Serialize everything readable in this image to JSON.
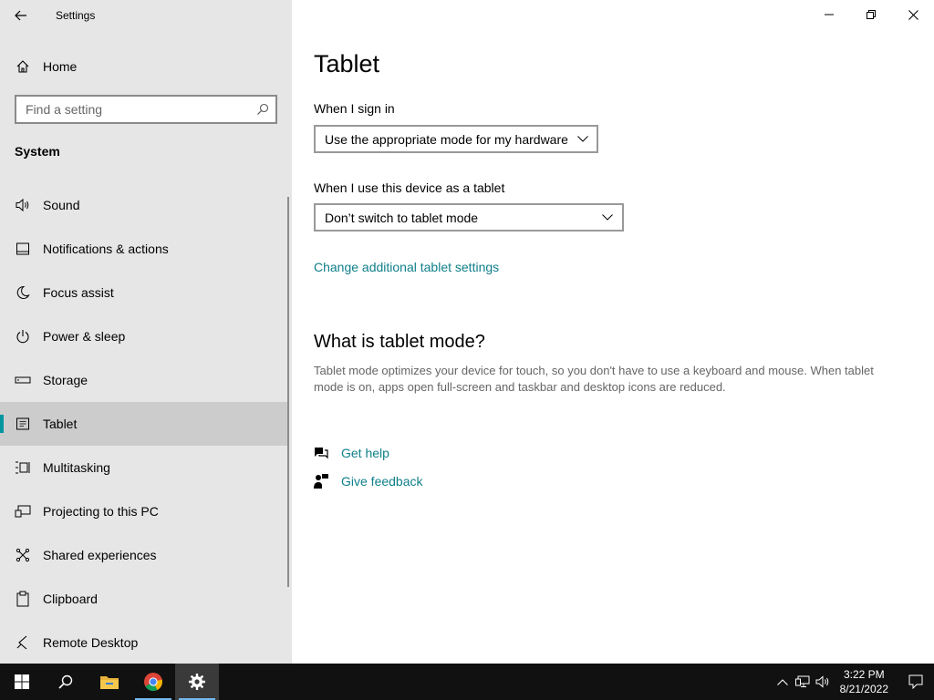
{
  "window": {
    "title": "Settings",
    "controls": [
      "minimize",
      "restore",
      "close"
    ]
  },
  "sidebar": {
    "home_label": "Home",
    "search_placeholder": "Find a setting",
    "section_title": "System",
    "items": [
      {
        "label": "Sound",
        "icon": "speaker-icon"
      },
      {
        "label": "Notifications & actions",
        "icon": "notification-icon"
      },
      {
        "label": "Focus assist",
        "icon": "moon-icon"
      },
      {
        "label": "Power & sleep",
        "icon": "power-icon"
      },
      {
        "label": "Storage",
        "icon": "storage-icon"
      },
      {
        "label": "Tablet",
        "icon": "tablet-icon",
        "active": true
      },
      {
        "label": "Multitasking",
        "icon": "multitasking-icon"
      },
      {
        "label": "Projecting to this PC",
        "icon": "projecting-icon"
      },
      {
        "label": "Shared experiences",
        "icon": "shared-experiences-icon"
      },
      {
        "label": "Clipboard",
        "icon": "clipboard-icon"
      },
      {
        "label": "Remote Desktop",
        "icon": "remote-desktop-icon"
      }
    ]
  },
  "main": {
    "title": "Tablet",
    "sign_in_label": "When I sign in",
    "sign_in_value": "Use the appropriate mode for my hardware",
    "tablet_use_label": "When I use this device as a tablet",
    "tablet_use_value": "Don’t switch to tablet mode",
    "additional_link": "Change additional tablet settings",
    "what_is_title": "What is tablet mode?",
    "what_is_desc": "Tablet mode optimizes your device for touch, so you don't have to use a keyboard and mouse. When tablet mode is on, apps open full-screen and taskbar and desktop icons are reduced.",
    "get_help": "Get help",
    "give_feedback": "Give feedback"
  },
  "taskbar": {
    "apps": [
      "start-icon",
      "search-icon",
      "file-explorer-icon",
      "chrome-icon",
      "settings-icon"
    ],
    "time": "3:22 PM",
    "date": "8/21/2022"
  },
  "colors": {
    "accent": "#0096a0",
    "link": "#0f7f89",
    "sidebar_bg": "#e6e6e6",
    "taskbar_bg": "#111111"
  }
}
